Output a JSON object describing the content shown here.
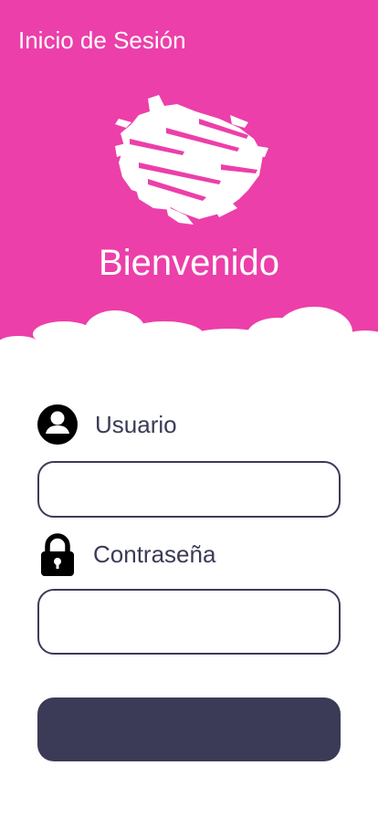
{
  "colors": {
    "header_background": "#ec3fa9",
    "primary_dark": "#3b3b57",
    "text_on_header": "#ffffff"
  },
  "header": {
    "title": "Inicio de Sesión",
    "welcome": "Bienvenido",
    "logo_icon": "white-brush-stroke-logo"
  },
  "form": {
    "username": {
      "icon": "user-circle-icon",
      "label": "Usuario",
      "value": "",
      "placeholder": ""
    },
    "password": {
      "icon": "lock-icon",
      "label": "Contraseña",
      "value": "",
      "placeholder": ""
    },
    "submit_label": ""
  }
}
